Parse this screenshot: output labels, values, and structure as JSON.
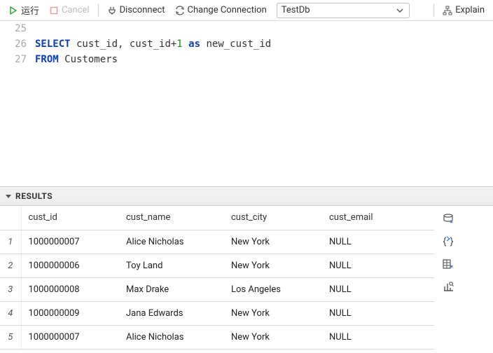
{
  "toolbar": {
    "run_label": "运行",
    "cancel_label": "Cancel",
    "disconnect_label": "Disconnect",
    "change_conn_label": "Change Connection",
    "db_selected": "TestDb",
    "explain_label": "Explain"
  },
  "editor": {
    "lines": [
      {
        "num": "25",
        "tokens": []
      },
      {
        "num": "26",
        "tokens": [
          {
            "t": "kw",
            "v": "SELECT"
          },
          {
            "t": "p",
            "v": " cust_id, cust_id+"
          },
          {
            "t": "num",
            "v": "1"
          },
          {
            "t": "p",
            "v": " "
          },
          {
            "t": "kw",
            "v": "as"
          },
          {
            "t": "p",
            "v": " new_cust_id"
          }
        ]
      },
      {
        "num": "27",
        "tokens": [
          {
            "t": "kw",
            "v": "FROM"
          },
          {
            "t": "p",
            "v": " Customers"
          }
        ]
      }
    ]
  },
  "results": {
    "title": "RESULTS",
    "columns": [
      "cust_id",
      "cust_name",
      "cust_city",
      "cust_email"
    ],
    "rows": [
      {
        "n": "1",
        "cells": [
          "1000000007",
          "Alice Nicholas",
          "New York",
          "NULL"
        ]
      },
      {
        "n": "2",
        "cells": [
          "1000000006",
          "Toy Land",
          "New York",
          "NULL"
        ]
      },
      {
        "n": "3",
        "cells": [
          "1000000008",
          "Max Drake",
          "Los Angeles",
          "NULL"
        ]
      },
      {
        "n": "4",
        "cells": [
          "1000000009",
          "Jana Edwards",
          "New York",
          "NULL"
        ]
      },
      {
        "n": "5",
        "cells": [
          "1000000007",
          "Alice Nicholas",
          "New York",
          "NULL"
        ]
      }
    ]
  }
}
